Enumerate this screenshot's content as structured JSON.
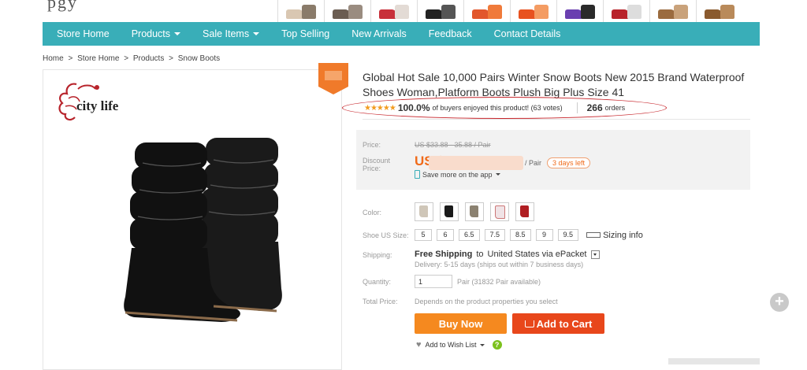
{
  "colors": {
    "nav_bg": "#39aeb8",
    "accent": "#f06b1a",
    "buy_btn": "#f5891f",
    "cart_btn": "#e8471b",
    "star": "#f29c1f",
    "circle": "#c7252b"
  },
  "header": {
    "logo_fragment": "pgy"
  },
  "nav": {
    "items": [
      {
        "label": "Store Home",
        "has_caret": false
      },
      {
        "label": "Products",
        "has_caret": true
      },
      {
        "label": "Sale Items",
        "has_caret": true
      },
      {
        "label": "Top Selling",
        "has_caret": false
      },
      {
        "label": "New Arrivals",
        "has_caret": false
      },
      {
        "label": "Feedback",
        "has_caret": false
      },
      {
        "label": "Contact Details",
        "has_caret": false
      }
    ]
  },
  "breadcrumb": {
    "home": "Home",
    "sep": ">",
    "store": "Store Home",
    "products": "Products",
    "current": "Snow Boots"
  },
  "brand": {
    "name": "city life"
  },
  "product": {
    "title": "Global Hot Sale 10,000 Pairs Winter Snow Boots New 2015 Brand Waterproof Shoes Woman,Platform Boots Plush Big Plus Size 41",
    "stars": "★★★★★",
    "rating_pct": "100.0%",
    "rating_text": "of buyers enjoyed this product! (63 votes)",
    "orders_count": "266",
    "orders_label": "orders"
  },
  "price": {
    "price_label": "Price:",
    "original": "US $33.88 - 35.88 / Pair",
    "discount_label": "Discount Price:",
    "discount_prefix": "US $",
    "unit": "/ Pair",
    "days_left": "3 days left",
    "save_app": "Save more on the app"
  },
  "options": {
    "color_label": "Color:",
    "color_swatches": [
      "beige",
      "black",
      "grey",
      "pink",
      "red"
    ],
    "size_label": "Shoe US Size:",
    "sizes": [
      "5",
      "6",
      "6.5",
      "7.5",
      "8.5",
      "9",
      "9.5"
    ],
    "sizing_info": "Sizing info"
  },
  "shipping": {
    "label": "Shipping:",
    "method": "Free Shipping",
    "to": "to",
    "destination": "United States via ePacket",
    "delivery": "Delivery: 5-15 days (ships out within 7 business days)"
  },
  "quantity": {
    "label": "Quantity:",
    "value": "1",
    "note": "Pair (31832 Pair available)"
  },
  "total": {
    "label": "Total Price:",
    "note": "Depends on the product properties you select"
  },
  "actions": {
    "buy_now": "Buy Now",
    "add_to_cart": "Add to Cart",
    "wish_list": "Add to Wish List",
    "help": "?"
  },
  "side": {
    "plus": "+"
  }
}
